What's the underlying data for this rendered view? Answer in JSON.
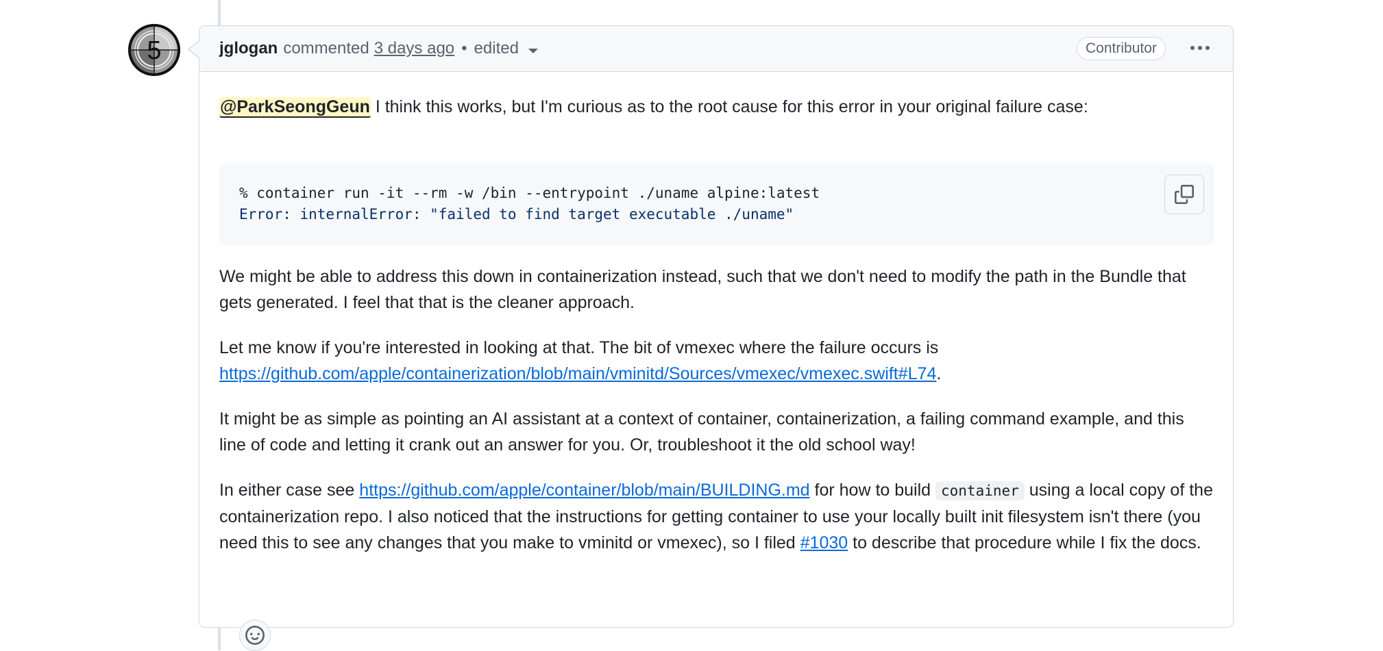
{
  "avatar": {
    "glyph": "5",
    "alt": "jglogan"
  },
  "header": {
    "author": "jglogan",
    "action": "commented",
    "time": "3 days ago",
    "separator": "•",
    "edited": "edited",
    "badge": "Contributor"
  },
  "body": {
    "p1": {
      "mention": "@ParkSeongGeun",
      "text": " I think this works, but I'm curious as to the root cause for this error in your original failure case:"
    },
    "code": {
      "line1": "% container run -it --rm -w /bin --entrypoint ./uname alpine:latest",
      "line2": "Error: internalError: \"failed to find target executable ./uname\""
    },
    "p2": "We might be able to address this down in containerization instead, such that we don't need to modify the path in the Bundle that gets generated. I feel that that is the cleaner approach.",
    "p3": {
      "text": "Let me know if you're interested in looking at that. The bit of vmexec where the failure occurs is ",
      "link": "https://github.com/apple/containerization/blob/main/vminitd/Sources/vmexec/vmexec.swift#L74",
      "tail": "."
    },
    "p4": "It might be as simple as pointing an AI assistant at a context of container, containerization, a failing command example, and this line of code and letting it crank out an answer for you. Or, troubleshoot it the old school way!",
    "p5": {
      "pre": "In either case see ",
      "link": "https://github.com/apple/container/blob/main/BUILDING.md",
      "mid1": " for how to build ",
      "code": "container",
      "mid2": " using a local copy of the containerization repo. I also noticed that the instructions for getting container to use your locally built init filesystem isn't there (you need this to see any changes that you make to vminitd or vmexec), so I filed ",
      "issue": "#1030",
      "tail": " to describe that procedure while I fix the docs."
    }
  },
  "icons": {
    "copy": "copy-icon",
    "kebab": "kebab-horizontal-icon",
    "reaction": "smiley-icon",
    "caret": "triangle-down-icon"
  },
  "colors": {
    "link": "#0969da",
    "mention_bg": "#fff8c5",
    "code_string": "#0a3069"
  }
}
